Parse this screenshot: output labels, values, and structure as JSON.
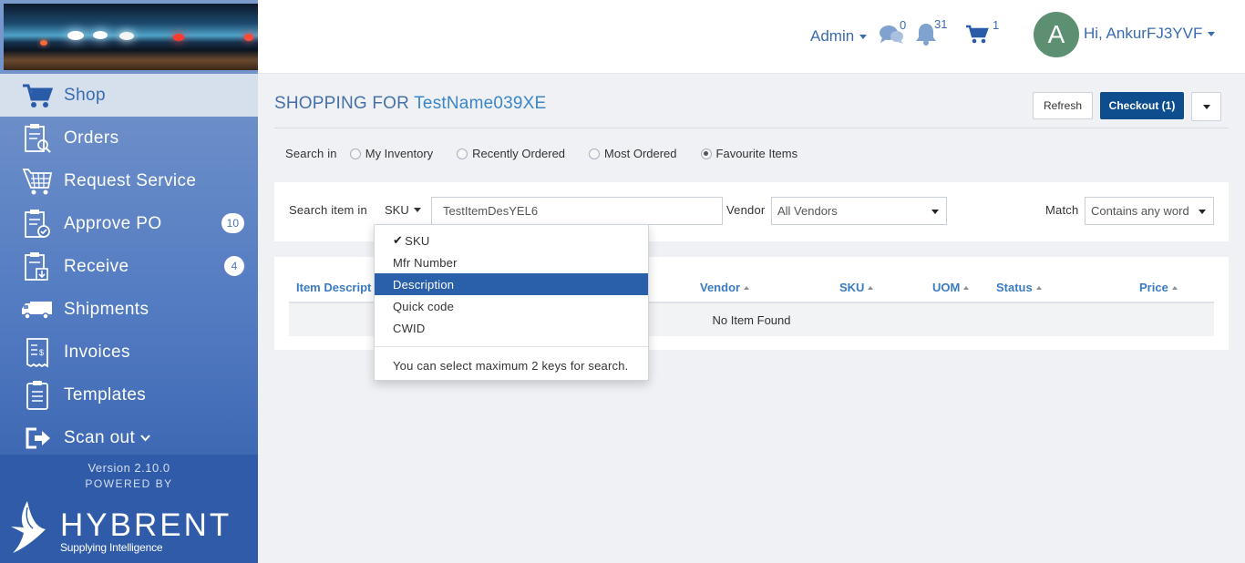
{
  "header": {
    "admin_label": "Admin",
    "messages_count": "0",
    "notifications_count": "31",
    "cart_count": "1",
    "avatar_initial": "A",
    "greeting": "Hi, AnkurFJ3YVF"
  },
  "sidebar": {
    "items": [
      {
        "label": "Shop",
        "icon": "cart-icon",
        "active": true
      },
      {
        "label": "Orders",
        "icon": "orders-icon"
      },
      {
        "label": "Request Service",
        "icon": "request-service-icon"
      },
      {
        "label": "Approve PO",
        "icon": "approve-po-icon",
        "badge": "10"
      },
      {
        "label": "Receive",
        "icon": "receive-icon",
        "badge": "4"
      },
      {
        "label": "Shipments",
        "icon": "truck-icon"
      },
      {
        "label": "Invoices",
        "icon": "invoice-icon"
      },
      {
        "label": "Templates",
        "icon": "templates-icon"
      },
      {
        "label": "Scan out",
        "icon": "scan-out-icon"
      }
    ],
    "version": "Version 2.10.0",
    "powered_by": "POWERED BY",
    "logo_text": "HYBRENT",
    "logo_tagline": "Supplying Intelligence"
  },
  "main": {
    "title_prefix": "SHOPPING FOR",
    "title_name": "TestName039XE",
    "refresh_label": "Refresh",
    "checkout_label": "Checkout (1)",
    "search_in": {
      "label": "Search in",
      "options": [
        "My Inventory",
        "Recently Ordered",
        "Most Ordered",
        "Favourite Items"
      ],
      "selected": "Favourite Items"
    },
    "search": {
      "label": "Search item in",
      "key_selected": "SKU",
      "value": "TestItemDesYEL6",
      "vendor_label": "Vendor",
      "vendor_value": "All Vendors",
      "match_label": "Match",
      "match_value": "Contains any word"
    },
    "table": {
      "columns": [
        "Item Descript",
        "Vendor",
        "SKU",
        "UOM",
        "Status",
        "Price"
      ],
      "empty_message": "No Item Found"
    }
  },
  "dropdown": {
    "items": [
      "SKU",
      "Mfr Number",
      "Description",
      "Quick code",
      "CWID"
    ],
    "checked": "SKU",
    "highlighted": "Description",
    "note": "You can select maximum 2 keys for search."
  },
  "colors": {
    "brand": "#2f5ba8",
    "accent": "#0e4e8e",
    "link": "#3a7cc2"
  }
}
